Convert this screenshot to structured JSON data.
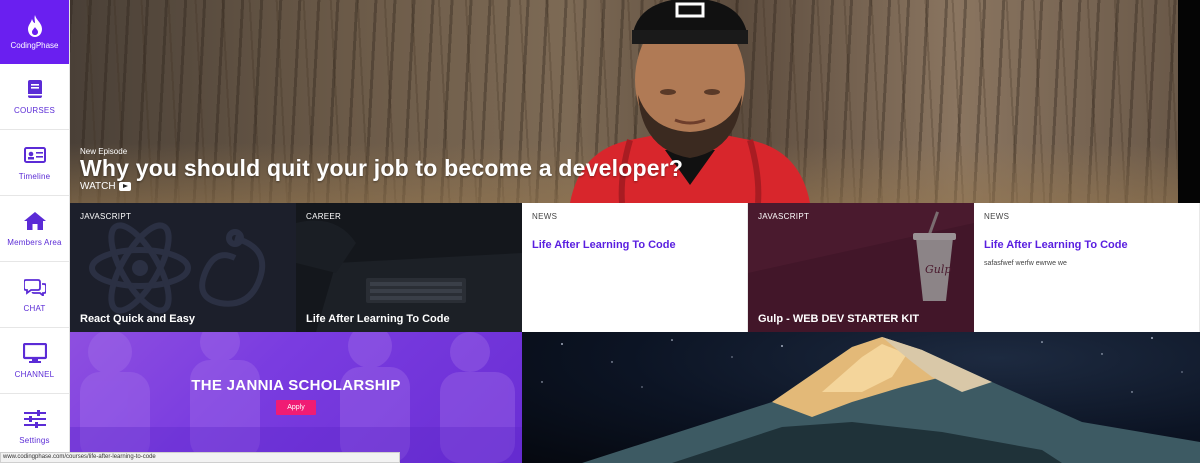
{
  "brand": {
    "name": "CodingPhase",
    "icon": "flame-icon",
    "color": "#6a1ff0"
  },
  "sidebar": {
    "items": [
      {
        "label": "COURSES",
        "icon": "book-icon"
      },
      {
        "label": "Timeline",
        "icon": "id-card-icon"
      },
      {
        "label": "Members Area",
        "icon": "home-icon"
      },
      {
        "label": "CHAT",
        "icon": "chat-bubbles-icon"
      },
      {
        "label": "CHANNEL",
        "icon": "monitor-icon"
      },
      {
        "label": "Settings",
        "icon": "sliders-icon"
      }
    ]
  },
  "hero": {
    "kicker": "New Episode",
    "title": "Why you should quit your job to become a developer?",
    "watch_label": "WATCH"
  },
  "cards": [
    {
      "category": "JAVASCRIPT",
      "title": "React Quick and Easy"
    },
    {
      "category": "CAREER",
      "title": "Life After Learning To Code"
    },
    {
      "category": "NEWS",
      "title": "Life After Learning To Code"
    },
    {
      "category": "JAVASCRIPT",
      "title": "Gulp - WEB DEV STARTER KIT"
    },
    {
      "category": "NEWS",
      "title": "Life After Learning To Code",
      "subtitle": "safasfwef werfw ewrwe we"
    }
  ],
  "promo": {
    "title": "THE JANNIA SCHOLARSHIP",
    "button": "Apply"
  },
  "statusbar": {
    "url": "www.codingphase.com/courses/life-after-learning-to-code"
  },
  "colors": {
    "accent": "#5a1fe0",
    "apply": "#f01c74"
  }
}
